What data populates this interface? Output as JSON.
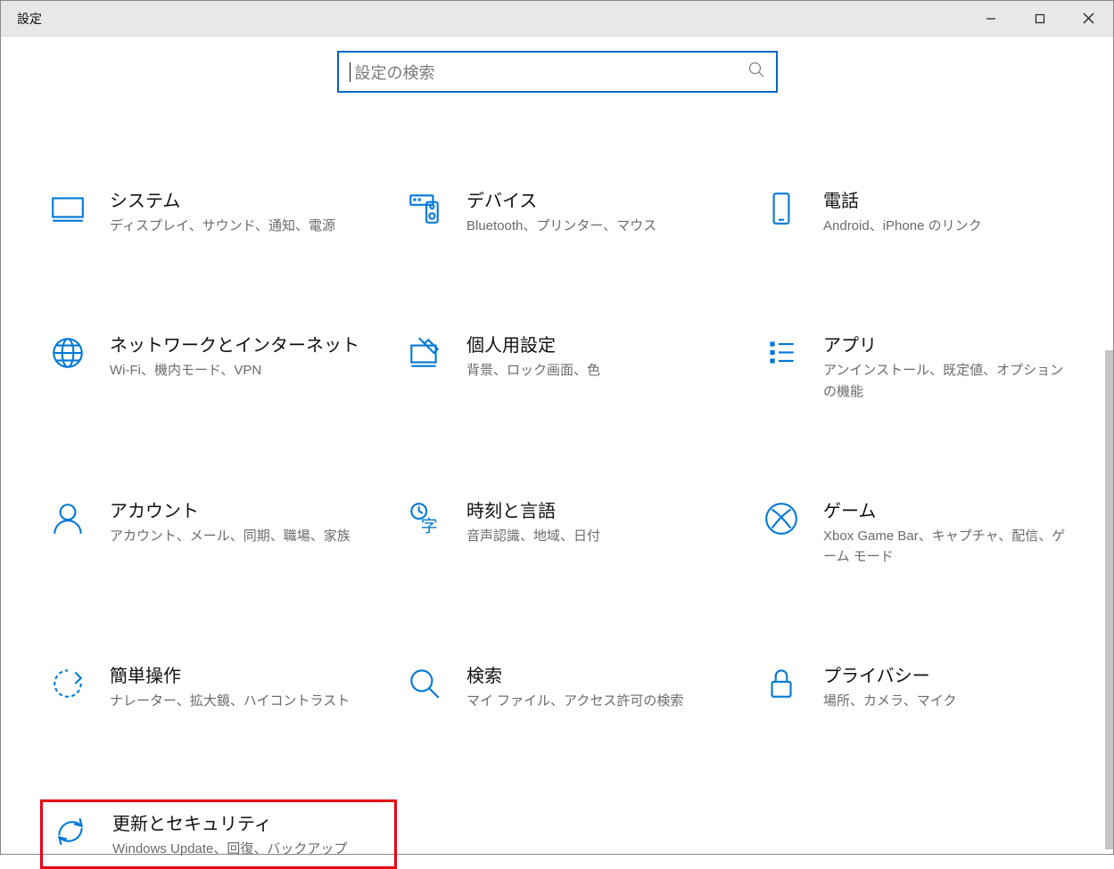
{
  "window": {
    "title": "設定"
  },
  "search": {
    "placeholder": "設定の検索"
  },
  "tiles": [
    {
      "title": "システム",
      "desc": "ディスプレイ、サウンド、通知、電源"
    },
    {
      "title": "デバイス",
      "desc": "Bluetooth、プリンター、マウス"
    },
    {
      "title": "電話",
      "desc": "Android、iPhone のリンク"
    },
    {
      "title": "ネットワークとインターネット",
      "desc": "Wi-Fi、機内モード、VPN"
    },
    {
      "title": "個人用設定",
      "desc": "背景、ロック画面、色"
    },
    {
      "title": "アプリ",
      "desc": "アンインストール、既定値、オプションの機能"
    },
    {
      "title": "アカウント",
      "desc": "アカウント、メール、同期、職場、家族"
    },
    {
      "title": "時刻と言語",
      "desc": "音声認識、地域、日付"
    },
    {
      "title": "ゲーム",
      "desc": "Xbox Game Bar、キャプチャ、配信、ゲーム モード"
    },
    {
      "title": "簡単操作",
      "desc": "ナレーター、拡大鏡、ハイコントラスト"
    },
    {
      "title": "検索",
      "desc": "マイ ファイル、アクセス許可の検索"
    },
    {
      "title": "プライバシー",
      "desc": "場所、カメラ、マイク"
    },
    {
      "title": "更新とセキュリティ",
      "desc": "Windows Update、回復、バックアップ"
    }
  ],
  "colors": {
    "accent": "#0078d7",
    "highlight": "#e60012"
  }
}
